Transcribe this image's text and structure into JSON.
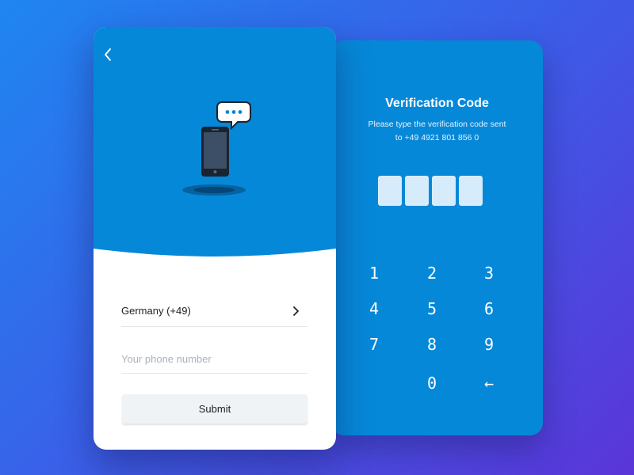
{
  "colors": {
    "accent": "#0688d8",
    "code_box": "#d7ecfb",
    "background_start": "#1f86f0",
    "background_end": "#5b35d8"
  },
  "login": {
    "back_icon": "chevron-left-icon",
    "illustration": "phone-message-icon",
    "country_label": "Germany  (+49)",
    "country_chevron_icon": "chevron-right-icon",
    "phone_placeholder": "Your phone number",
    "phone_value": "",
    "submit_label": "Submit"
  },
  "verification": {
    "title": "Verification Code",
    "subtitle_line1": "Please type the verification code sent",
    "subtitle_line2": "to +49 4921 801 856 0",
    "code_digits": [
      "",
      "",
      "",
      ""
    ],
    "keypad": [
      "1",
      "2",
      "3",
      "4",
      "5",
      "6",
      "7",
      "8",
      "9",
      "0",
      "←"
    ],
    "backspace_icon": "backspace-arrow-icon"
  }
}
